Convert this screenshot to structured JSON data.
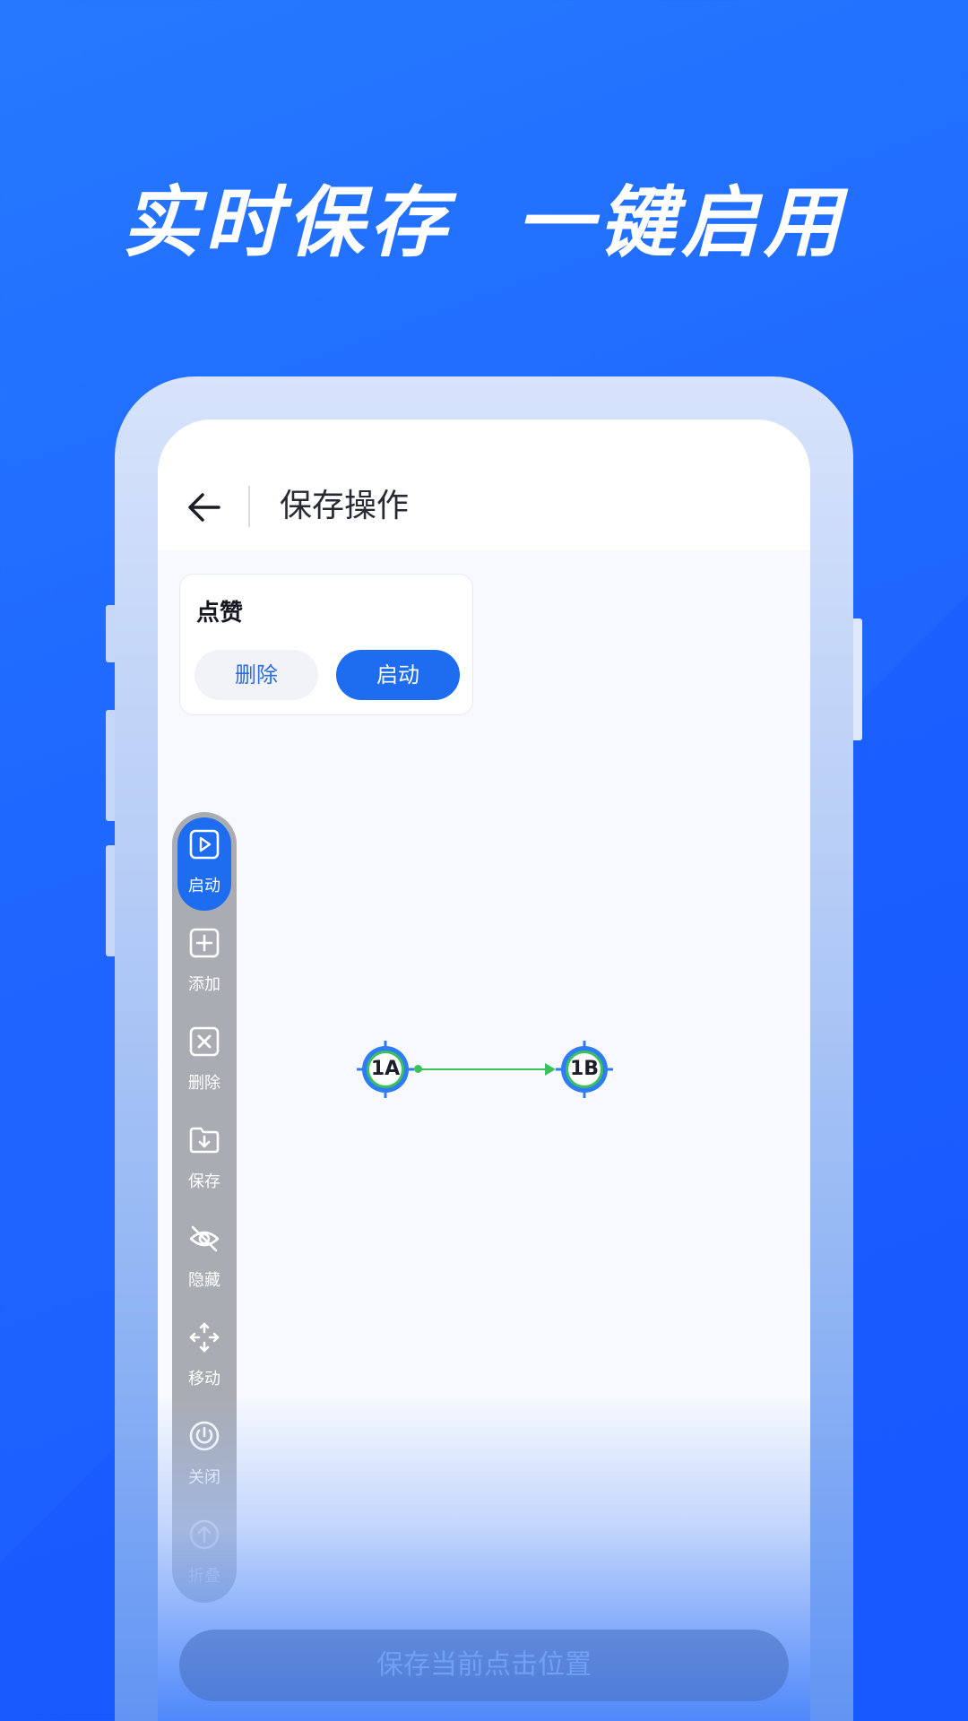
{
  "headline": "实时保存  一键启用",
  "colors": {
    "accent": "#1e6cf0",
    "node_ring": "#2f7cf5",
    "node_inner_ring": "#3cc25d",
    "link": "#3cc25d",
    "toolbar_bg": "#a9acb3"
  },
  "header": {
    "back_icon": "arrow-left-icon",
    "title": "保存操作"
  },
  "card": {
    "title": "点赞",
    "delete_label": "删除",
    "start_label": "启动"
  },
  "toolbar": {
    "items": [
      {
        "icon": "play-square-icon",
        "label": "启动",
        "active": true
      },
      {
        "icon": "plus-square-icon",
        "label": "添加",
        "active": false
      },
      {
        "icon": "x-square-icon",
        "label": "删除",
        "active": false
      },
      {
        "icon": "folder-download-icon",
        "label": "保存",
        "active": false
      },
      {
        "icon": "eye-off-icon",
        "label": "隐藏",
        "active": false
      },
      {
        "icon": "move-arrows-icon",
        "label": "移动",
        "active": false
      },
      {
        "icon": "power-icon",
        "label": "关闭",
        "active": false
      },
      {
        "icon": "arrow-up-circle-icon",
        "label": "折叠",
        "active": false
      }
    ]
  },
  "nodes": [
    {
      "label": "1A"
    },
    {
      "label": "1B"
    }
  ],
  "bottom_button": {
    "label": "保存当前点击位置"
  }
}
